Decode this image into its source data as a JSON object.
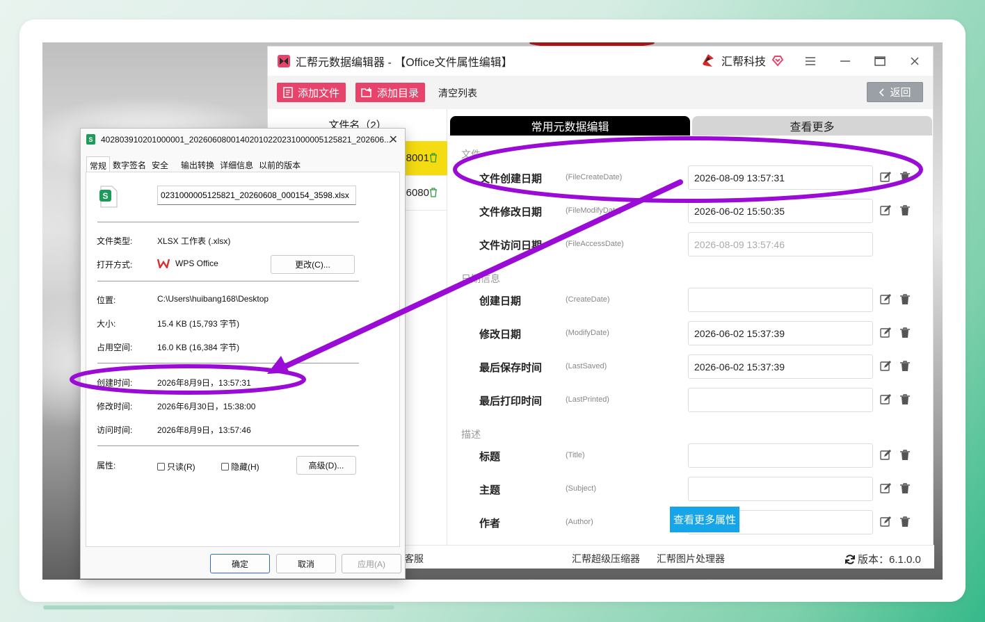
{
  "app": {
    "title": "汇帮元数据编辑器 - 【Office文件属性编辑】",
    "brand": "汇帮科技",
    "colors": {
      "accent_pink": "#e8436a",
      "highlight_yellow": "#f5dc12",
      "annotation_purple": "#9a0cd6",
      "blue_button": "#16a5e8"
    },
    "toolbar": {
      "add_file": "添加文件",
      "add_dir": "添加目录",
      "clear_list": "清空列表",
      "back": "返回"
    },
    "file_list": {
      "header": "文件名（2）",
      "items": [
        {
          "name": "8001"
        },
        {
          "name": "6080"
        }
      ]
    },
    "tabs": {
      "active": "常用元数据编辑",
      "inactive": "查看更多"
    },
    "sections": {
      "file": "文件",
      "date": "日期信息",
      "desc": "描述"
    },
    "fields": [
      {
        "label": "文件创建日期",
        "key": "(FileCreateDate)",
        "value": "2026-08-09 13:57:31"
      },
      {
        "label": "文件修改日期",
        "key": "(FileModifyDate)",
        "value": "2026-06-02 15:50:35"
      },
      {
        "label": "文件访问日期",
        "key": "(FileAccessDate)",
        "value": "2026-08-09 13:57:46"
      },
      {
        "label": "创建日期",
        "key": "(CreateDate)",
        "value": ""
      },
      {
        "label": "修改日期",
        "key": "(ModifyDate)",
        "value": "2026-06-02 15:37:39"
      },
      {
        "label": "最后保存时间",
        "key": "(LastSaved)",
        "value": "2026-06-02 15:37:39"
      },
      {
        "label": "最后打印时间",
        "key": "(LastPrinted)",
        "value": ""
      },
      {
        "label": "标题",
        "key": "(Title)",
        "value": ""
      },
      {
        "label": "主题",
        "key": "(Subject)",
        "value": ""
      },
      {
        "label": "作者",
        "key": "(Author)",
        "value": ""
      }
    ],
    "more_button": "查看更多属性",
    "status": {
      "service": "客服",
      "compressor": "汇帮超级压缩器",
      "image_tool": "汇帮图片处理器",
      "version": "版本：6.1.0.0"
    }
  },
  "dialog": {
    "title": "402803910201000001_20260608001402010220231000005125821_202606...",
    "tabs": [
      "常规",
      "数字签名",
      "安全",
      "输出转换",
      "详细信息",
      "以前的版本"
    ],
    "file_name": "0231000005125821_20260608_000154_3598.xlsx",
    "file_type_label": "文件类型:",
    "file_type": "XLSX 工作表 (.xlsx)",
    "open_with_label": "打开方式:",
    "open_with": "WPS Office",
    "change_button": "更改(C)...",
    "location_label": "位置:",
    "location": "C:\\Users\\huibang168\\Desktop",
    "size_label": "大小:",
    "size": "15.4 KB (15,793 字节)",
    "disk_size_label": "占用空间:",
    "disk_size": "16.0 KB (16,384 字节)",
    "created_label": "创建时间:",
    "created": "2026年8月9日，13:57:31",
    "modified_label": "修改时间:",
    "modified": "2026年6月30日，15:38:00",
    "accessed_label": "访问时间:",
    "accessed": "2026年8月9日，13:57:46",
    "attrs_label": "属性:",
    "readonly": "只读(R)",
    "hidden": "隐藏(H)",
    "advanced_button": "高级(D)...",
    "ok": "确定",
    "cancel": "取消",
    "apply": "应用(A)"
  }
}
